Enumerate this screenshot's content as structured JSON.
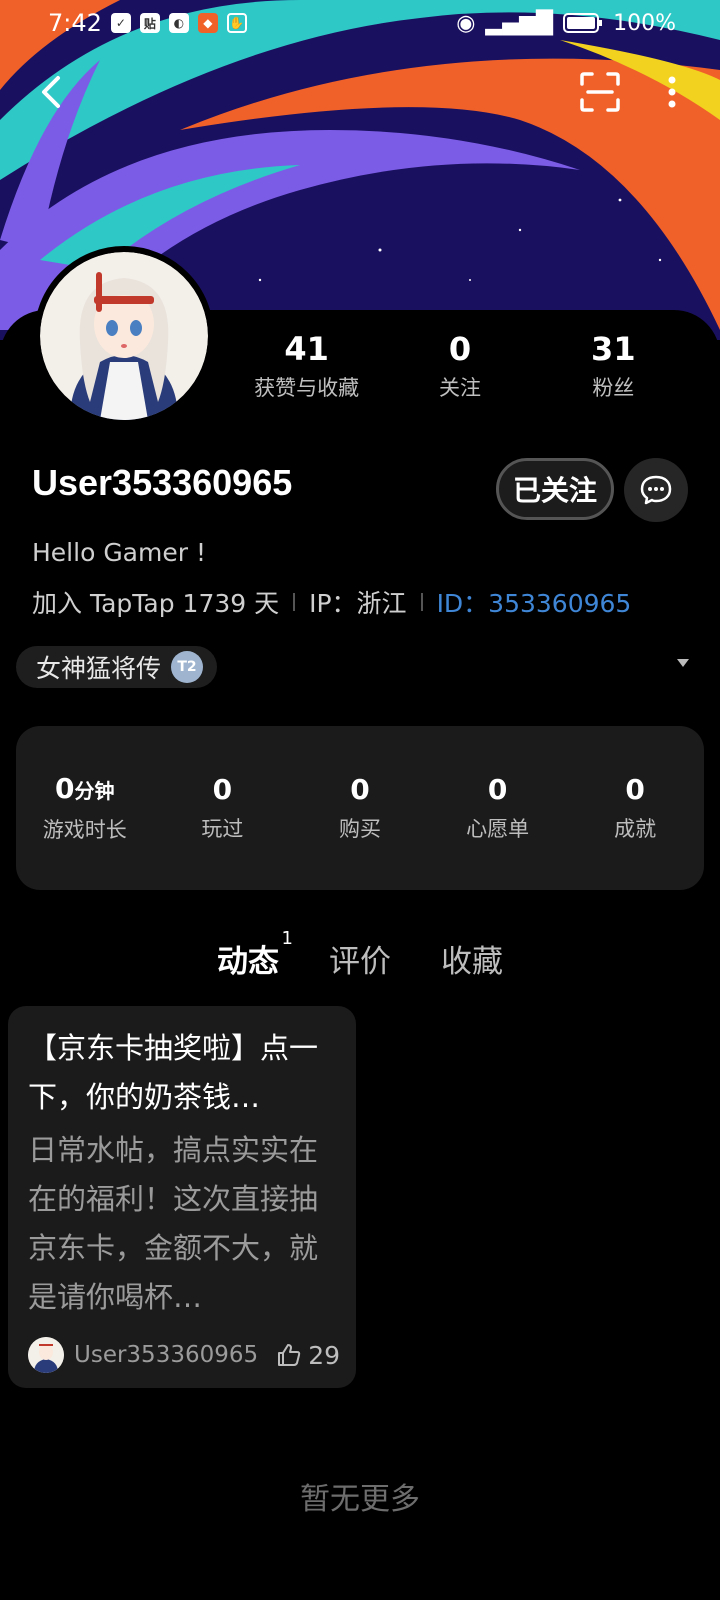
{
  "status_bar": {
    "time": "7:42",
    "battery": "100%",
    "icons": [
      "shield-icon",
      "tieba-icon",
      "app-icon",
      "shop-icon",
      "hand-icon",
      "eye-icon",
      "signal-icon",
      "battery-icon"
    ]
  },
  "nav": {
    "back_icon": "back-arrow-icon",
    "scan_icon": "scan-icon",
    "more_icon": "more-vertical-icon"
  },
  "profile": {
    "stats": [
      {
        "value": "41",
        "label": "获赞与收藏"
      },
      {
        "value": "0",
        "label": "关注"
      },
      {
        "value": "31",
        "label": "粉丝"
      }
    ],
    "username": "User353360965",
    "follow_label": "已关注",
    "bio": "Hello Gamer !",
    "join_info": "加入 TapTap 1739 天",
    "ip_info": "IP：浙江",
    "id_info": "ID：353360965"
  },
  "game_tag": {
    "name": "女神猛将传",
    "badge": "T2"
  },
  "stats_card": [
    {
      "value": "0",
      "unit": "分钟",
      "label": "游戏时长"
    },
    {
      "value": "0",
      "label": "玩过"
    },
    {
      "value": "0",
      "label": "购买"
    },
    {
      "value": "0",
      "label": "心愿单"
    },
    {
      "value": "0",
      "label": "成就"
    }
  ],
  "tabs": [
    {
      "label": "动态",
      "count": "1",
      "active": true
    },
    {
      "label": "评价"
    },
    {
      "label": "收藏"
    }
  ],
  "posts": [
    {
      "title": "【京东卡抽奖啦】点一下，你的奶茶钱…",
      "body": "日常水帖，搞点实实在在的福利！这次直接抽京东卡，金额不大，就是请你喝杯…",
      "author": "User353360965",
      "likes": "29"
    }
  ],
  "footer_text": "暂无更多",
  "colors": {
    "accent_teal": "#14c9c9",
    "id_blue": "#3f86d6",
    "banner_navy": "#1a1060",
    "banner_orange": "#f0612a",
    "banner_purple": "#7b5ce6",
    "banner_yellow": "#f2d21e"
  }
}
